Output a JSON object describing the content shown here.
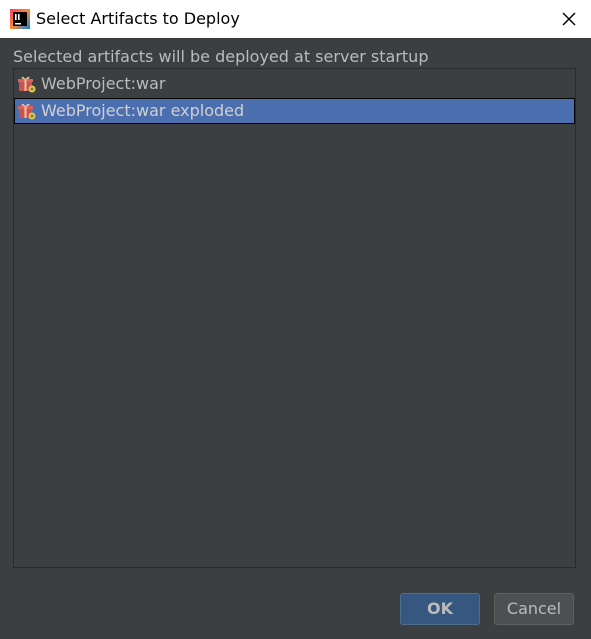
{
  "window": {
    "title": "Select Artifacts to Deploy",
    "app_icon": "intellij-idea-icon",
    "close_icon": "close-icon"
  },
  "dialog": {
    "subtitle": "Selected artifacts will be deployed at server startup",
    "artifacts": [
      {
        "label": "WebProject:war",
        "icon": "artifact-gift-icon",
        "selected": false
      },
      {
        "label": "WebProject:war exploded",
        "icon": "artifact-gift-icon",
        "selected": true
      }
    ]
  },
  "buttons": {
    "ok_label": "OK",
    "cancel_label": "Cancel"
  },
  "colors": {
    "background": "#3c3f41",
    "selection": "#4b6eaf",
    "ok_button": "#365880",
    "text": "#bbbbbb"
  }
}
